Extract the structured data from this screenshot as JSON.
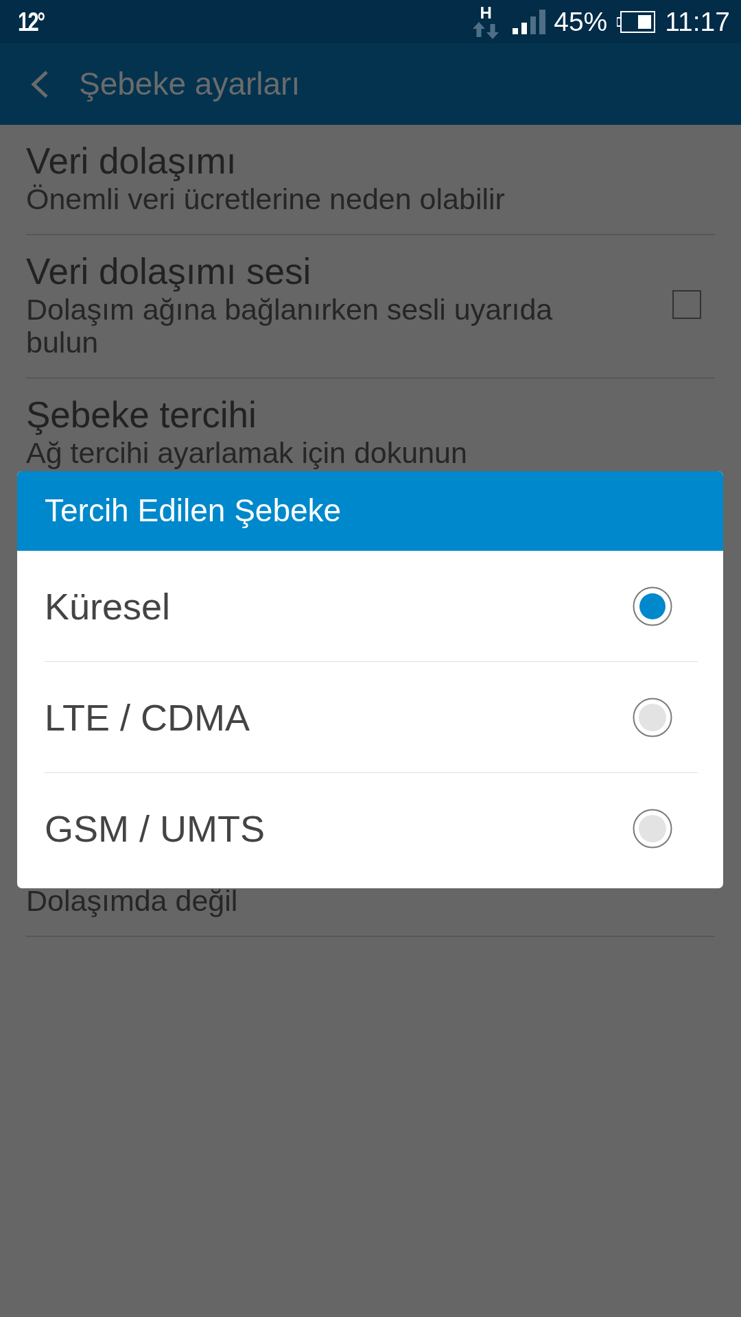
{
  "status_bar": {
    "temperature": "12°",
    "network_type": "H",
    "battery": "45%",
    "time": "11:17"
  },
  "app_bar": {
    "title": "Şebeke ayarları"
  },
  "settings": [
    {
      "kind": "text",
      "title": "Veri dolaşımı",
      "subtitle": "Önemli veri ücretlerine neden olabilir"
    },
    {
      "kind": "checkbox",
      "title": "Veri dolaşımı sesi",
      "subtitle": "Dolaşım ağına bağlanırken sesli uyarıda bulun",
      "checked": false
    },
    {
      "kind": "text",
      "title": "Şebeke tercihi",
      "subtitle": "Ağ tercihi ayarlamak için dokunun"
    },
    {
      "kind": "text",
      "subtitle": "Dolaşımda değil"
    }
  ],
  "dialog": {
    "title": "Tercih Edilen Şebeke",
    "options": [
      {
        "label": "Küresel",
        "selected": true
      },
      {
        "label": "LTE / CDMA",
        "selected": false
      },
      {
        "label": "GSM / UMTS",
        "selected": false
      }
    ]
  }
}
